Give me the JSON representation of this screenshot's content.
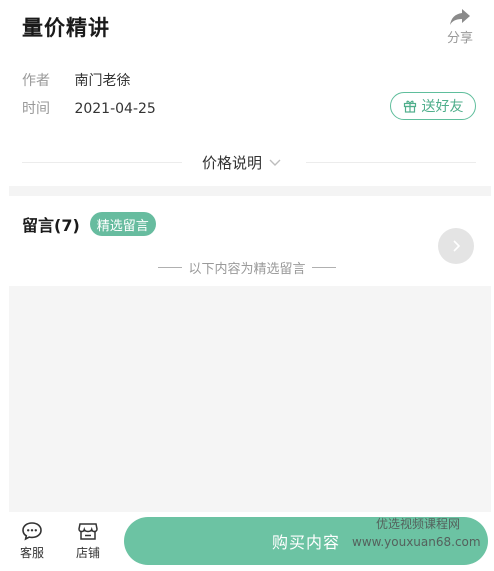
{
  "header": {
    "title": "量价精讲",
    "share_label": "分享"
  },
  "meta": {
    "author_key": "作者",
    "author_value": "南门老徐",
    "time_key": "时间",
    "time_value": "2021-04-25",
    "gift_label": "送好友"
  },
  "price": {
    "label": "价格说明"
  },
  "comments": {
    "title": "留言(7)",
    "badge": "精选留言",
    "note": "以下内容为精选留言"
  },
  "bottom": {
    "service_label": "客服",
    "store_label": "店铺",
    "buy_label": "购买内容"
  },
  "watermark": {
    "cn": "优选视频课程网",
    "url": "www.youxuan68.com"
  },
  "colors": {
    "accent": "#6cc3a3",
    "accent_text": "#4fae8b"
  }
}
